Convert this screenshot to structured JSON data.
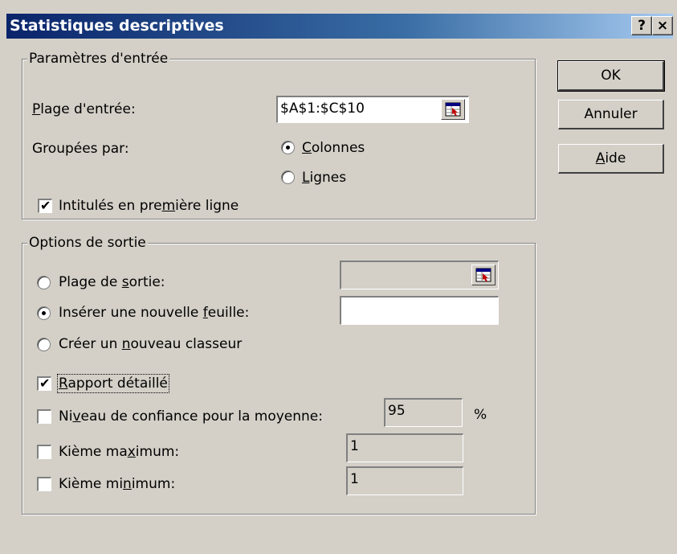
{
  "window": {
    "title": "Statistiques descriptives",
    "help_glyph": "?",
    "close_glyph": "×"
  },
  "input_group": {
    "legend": "Paramètres d'entrée",
    "range_label": {
      "pre": "",
      "u": "P",
      "post": "lage d'entrée:"
    },
    "range_value": "$A$1:$C$10",
    "grouped_label": "Groupées par:",
    "columns": {
      "pre": "",
      "u": "C",
      "post": "olonnes",
      "selected": true
    },
    "rows": {
      "pre": "",
      "u": "L",
      "post": "ignes",
      "selected": false
    },
    "labels_first_row": {
      "pre": "Intitulés en pre",
      "u": "m",
      "post": "ière ligne",
      "checked": true
    }
  },
  "output_group": {
    "legend": "Options de sortie",
    "output_range": {
      "pre": "Plage de ",
      "u": "s",
      "post": "ortie:",
      "selected": false,
      "value": ""
    },
    "new_sheet": {
      "pre": "Insérer une nouvelle ",
      "u": "f",
      "post": "euille:",
      "selected": true,
      "value": ""
    },
    "new_workbook": {
      "pre": "Créer un ",
      "u": "n",
      "post": "ouveau classeur",
      "selected": false
    },
    "summary": {
      "pre": "",
      "u": "R",
      "post": "apport détaillé",
      "checked": true
    },
    "confidence": {
      "pre": "Ni",
      "u": "v",
      "post": "eau de confiance pour la moyenne:",
      "checked": false,
      "value": "95",
      "unit": "%"
    },
    "kth_largest": {
      "pre": "Kième ma",
      "u": "x",
      "post": "imum:",
      "checked": false,
      "value": "1"
    },
    "kth_smallest": {
      "pre": "Kième mi",
      "u": "n",
      "post": "imum:",
      "checked": false,
      "value": "1"
    }
  },
  "buttons": {
    "ok": "OK",
    "cancel": "Annuler",
    "help": {
      "pre": "",
      "u": "A",
      "post": "ide"
    }
  }
}
